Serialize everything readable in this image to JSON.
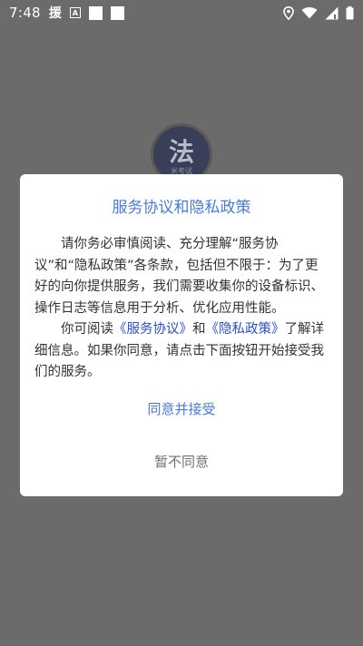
{
  "status_bar": {
    "time": "7:48",
    "app_glyph": "援",
    "box_glyph": "A",
    "icons": [
      "location-icon",
      "wifi-icon",
      "signal-icon",
      "battery-icon"
    ]
  },
  "background": {
    "logo_char": "法",
    "logo_sub": "米考试"
  },
  "dialog": {
    "title": "服务协议和隐私政策",
    "para1": "请你务必审慎阅读、充分理解“服务协议”和“隐私政策”各条款，包括但不限于：为了更好的向你提供服务，我们需要收集你的设备标识、操作日志等信息用于分析、优化应用性能。",
    "para2_prefix": "你可阅读",
    "link_service": "《服务协议》",
    "para2_and": "和",
    "link_privacy": "《隐私政策》",
    "para2_suffix": "了解详细信息。如果你同意，请点击下面按钮开始接受我们的服务。",
    "accept_label": "同意并接受",
    "decline_label": "暂不同意"
  },
  "colors": {
    "accent": "#4a7bd6",
    "link": "#2b4fd0",
    "overlay": "#6b6b6b"
  }
}
